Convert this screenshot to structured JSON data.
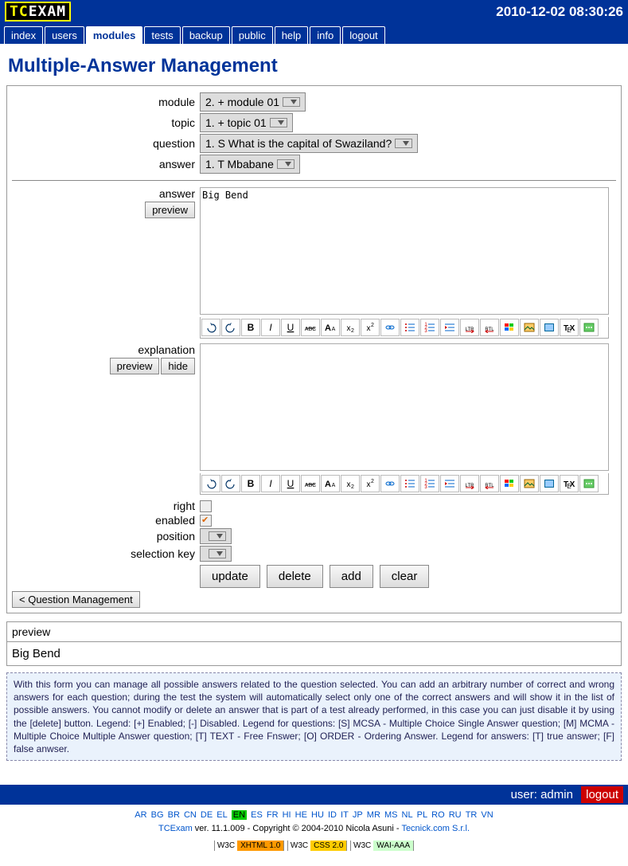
{
  "header": {
    "logo_tc": "TC",
    "logo_exam": "EXAM",
    "timestamp": "2010-12-02 08:30:26"
  },
  "nav": {
    "items": [
      "index",
      "users",
      "modules",
      "tests",
      "backup",
      "public",
      "help",
      "info",
      "logout"
    ],
    "active": 2
  },
  "title": "Multiple-Answer Management",
  "form": {
    "module": {
      "label": "module",
      "value": "2. + module 01"
    },
    "topic": {
      "label": "topic",
      "value": "1. + topic 01"
    },
    "question": {
      "label": "question",
      "value": "1. S What is the capital of Swaziland?"
    },
    "answer_sel": {
      "label": "answer",
      "value": "1. T Mbabane"
    },
    "answer": {
      "label": "answer",
      "preview_btn": "preview",
      "value": "Big Bend"
    },
    "explanation": {
      "label": "explanation",
      "preview_btn": "preview",
      "hide_btn": "hide",
      "value": ""
    },
    "right": {
      "label": "right",
      "checked": false
    },
    "enabled": {
      "label": "enabled",
      "checked": true
    },
    "position": {
      "label": "position",
      "value": ""
    },
    "selection_key": {
      "label": "selection key",
      "value": ""
    }
  },
  "buttons": {
    "update": "update",
    "delete": "delete",
    "add": "add",
    "clear": "clear",
    "back": "< Question Management"
  },
  "preview": {
    "title": "preview",
    "body": "Big Bend"
  },
  "help": "With this form you can manage all possible answers related to the question selected. You can add an arbitrary number of correct and wrong answers for each question; during the test the system will automatically select only one of the correct answers and will show it in the list of possible answers. You cannot modify or delete an answer that is part of a test already performed, in this case you can just disable it by using the [delete] button. Legend: [+] Enabled; [-] Disabled. Legend for questions: [S] MCSA - Multiple Choice Single Answer question; [M] MCMA - Multiple Choice Multiple Answer question; [T] TEXT - Free Fnswer; [O] ORDER - Ordering Answer. Legend for answers: [T] true answer; [F] false anwser.",
  "footer": {
    "user_label": "user:",
    "user": "admin",
    "logout": "logout"
  },
  "langs": [
    "AR",
    "BG",
    "BR",
    "CN",
    "DE",
    "EL",
    "EN",
    "ES",
    "FR",
    "HI",
    "HE",
    "HU",
    "ID",
    "IT",
    "JP",
    "MR",
    "MS",
    "NL",
    "PL",
    "RO",
    "RU",
    "TR",
    "VN"
  ],
  "lang_cur": "EN",
  "copy": {
    "app": "TCExam",
    "ver": " ver. 11.1.009 - Copyright © 2004-2010 Nicola Asuni - ",
    "link": "Tecnick.com S.r.l."
  },
  "badges": [
    {
      "l": "W3C",
      "r": "XHTML 1.0",
      "c": "#f90"
    },
    {
      "l": "W3C",
      "r": "CSS 2.0",
      "c": "#fc0"
    },
    {
      "l": "W3C",
      "r": "WAI-AAA",
      "c": "#cfc"
    }
  ],
  "toolbar_icons": [
    "undo",
    "redo",
    "bold",
    "italic",
    "underline",
    "strike",
    "font",
    "sub",
    "sup",
    "link",
    "ul",
    "ol",
    "indent",
    "ltr",
    "rtl",
    "color",
    "image",
    "object",
    "tex",
    "more"
  ]
}
